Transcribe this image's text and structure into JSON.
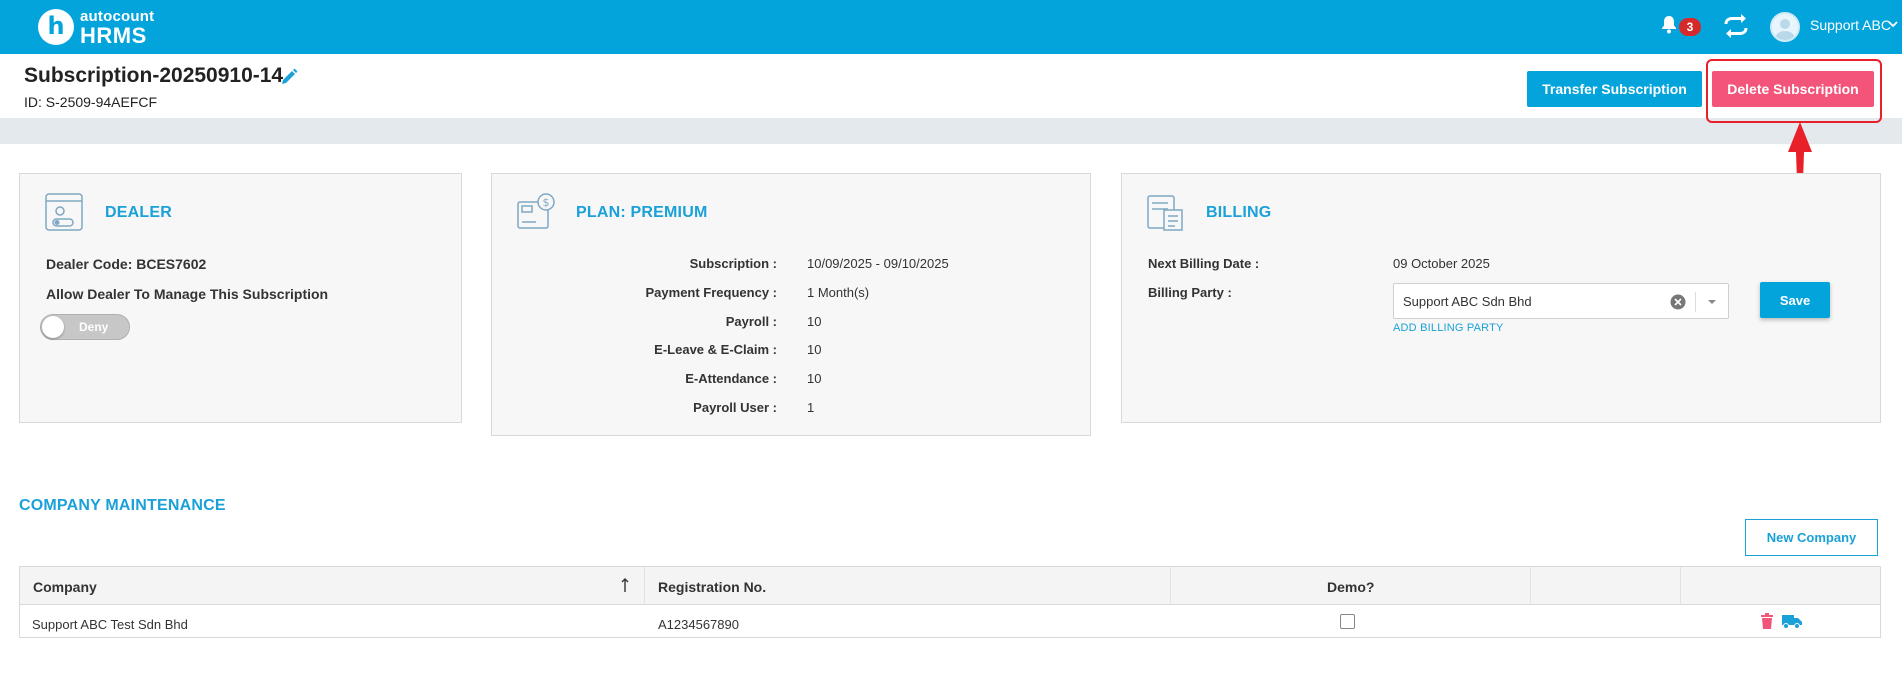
{
  "app": {
    "logo_top": "autocount",
    "logo_bottom": "HRMS",
    "logo_mark": "h"
  },
  "topbar": {
    "notification_count": "3",
    "user_name": "Support ABC"
  },
  "header": {
    "title": "Subscription-20250910-14",
    "id_text": "ID: S-2509-94AEFCF",
    "transfer_label": "Transfer Subscription",
    "delete_label": "Delete Subscription"
  },
  "dealer": {
    "title": "DEALER",
    "code_text": "Dealer Code: BCES7602",
    "allow_label": "Allow Dealer To Manage This Subscription",
    "toggle_label": "Deny"
  },
  "plan": {
    "title": "PLAN: PREMIUM",
    "rows": [
      {
        "key": "Subscription :",
        "value": "10/09/2025 - 09/10/2025"
      },
      {
        "key": "Payment Frequency :",
        "value": "1 Month(s)"
      },
      {
        "key": "Payroll :",
        "value": "10"
      },
      {
        "key": "E-Leave & E-Claim :",
        "value": "10"
      },
      {
        "key": "E-Attendance :",
        "value": "10"
      },
      {
        "key": "Payroll User :",
        "value": "1"
      }
    ]
  },
  "billing": {
    "title": "BILLING",
    "next_date_label": "Next Billing Date :",
    "next_date_value": "09 October 2025",
    "party_label": "Billing Party :",
    "party_value": "Support ABC Sdn Bhd",
    "add_party_link": "ADD BILLING PARTY",
    "save_label": "Save"
  },
  "company_maintenance": {
    "title": "COMPANY MAINTENANCE",
    "new_company_label": "New Company",
    "columns": [
      "Company",
      "Registration No.",
      "Demo?"
    ],
    "rows": [
      {
        "company": "Support ABC Test Sdn Bhd",
        "registration": "A1234567890",
        "demo": false
      }
    ]
  },
  "colors": {
    "primary": "#03a4dc",
    "danger": "#f2547a",
    "highlight": "#e8202a"
  }
}
